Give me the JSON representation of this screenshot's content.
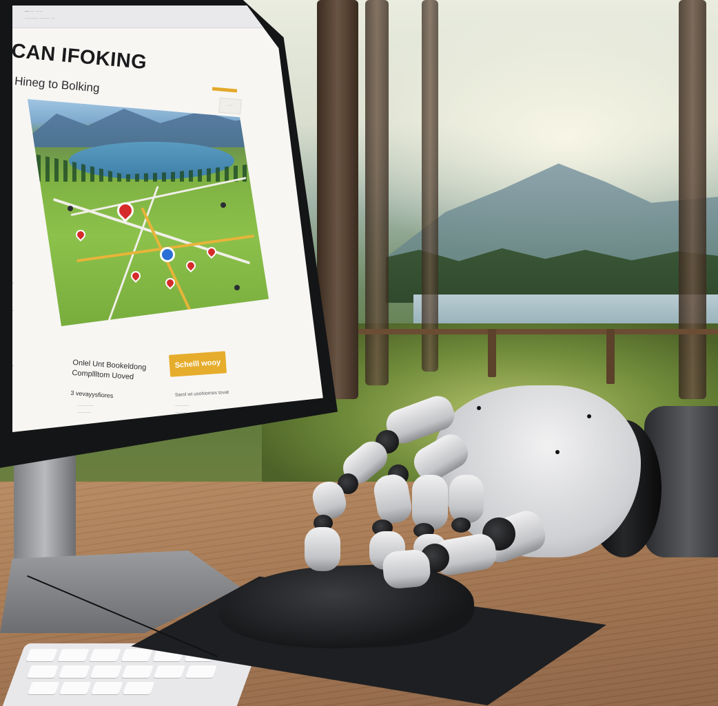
{
  "browser": {
    "tab_line_1": "— ··· ·····",
    "tab_line_2": "·········· ······· ···"
  },
  "page": {
    "title": "CAN IFOKING",
    "subtitle": "Hineg to Bolking",
    "side_box": "···"
  },
  "booking": {
    "heading": "Onlel Unt Bookeldong",
    "subheading": "Compllltom Uoved",
    "detail": "3 vevayysfiores",
    "cta_label": "Schelll wooy",
    "right_heading": "Sarol wt usohiomes tovat"
  },
  "colors": {
    "accent": "#e6ad2c",
    "pin": "#d62b2b",
    "pin_blue": "#2a6fd6"
  },
  "icons": {
    "location_pin": "map-pin-icon",
    "center_marker": "target-marker-icon"
  }
}
